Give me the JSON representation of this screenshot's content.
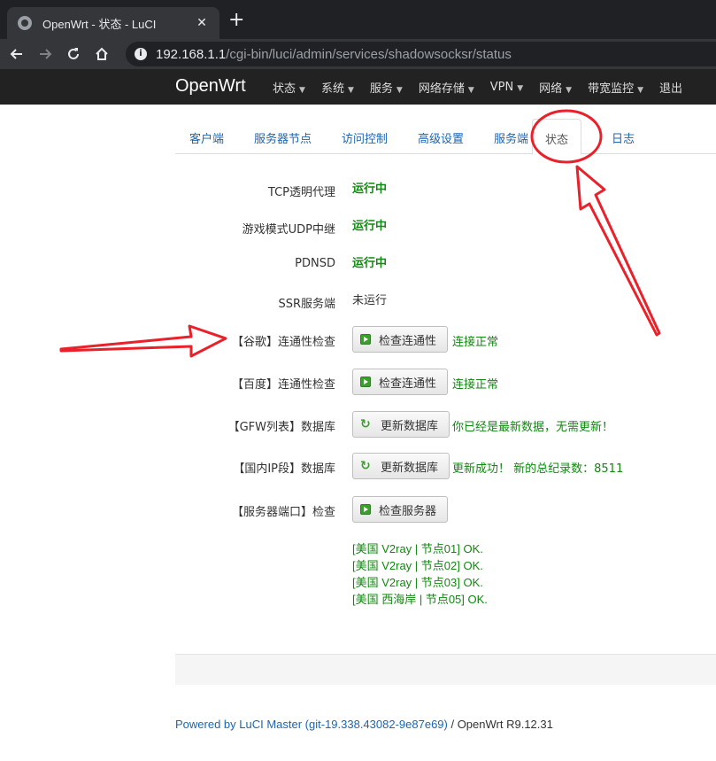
{
  "browser": {
    "tab_title": "OpenWrt - 状态 - LuCI",
    "tab_close": "✕",
    "new_tab": "+",
    "url_host": "192.168.1.1",
    "url_path": "/cgi-bin/luci/admin/services/shadowsocksr/status"
  },
  "header": {
    "brand": "OpenWrt",
    "menu": [
      "状态",
      "系统",
      "服务",
      "网络存储",
      "VPN",
      "网络",
      "带宽监控",
      "退出"
    ]
  },
  "subtabs": [
    "客户端",
    "服务器节点",
    "访问控制",
    "高级设置",
    "服务端",
    "状态",
    "日志"
  ],
  "status_rows": [
    {
      "label": "TCP透明代理",
      "value": "运行中"
    },
    {
      "label": "游戏模式UDP中继",
      "value": "运行中"
    },
    {
      "label": "PDNSD",
      "value": "运行中"
    },
    {
      "label": "SSR服务端",
      "value": "未运行"
    }
  ],
  "action_rows": [
    {
      "label": "【谷歌】连通性检查",
      "button": "检查连通性",
      "result": "连接正常"
    },
    {
      "label": "【百度】连通性检查",
      "button": "检查连通性",
      "result": "连接正常"
    },
    {
      "label": "【GFW列表】数据库",
      "button": "更新数据库",
      "result": "你已经是最新数据，无需更新！"
    },
    {
      "label": "【国内IP段】数据库",
      "button": "更新数据库",
      "result": "更新成功！ 新的总纪录数：8511"
    },
    {
      "label": "【服务器端口】检查",
      "button": "检查服务器",
      "result": ""
    }
  ],
  "server_results": [
    "[美国 V2ray | 节点01] OK.",
    "[美国 V2ray | 节点02] OK.",
    "[美国 V2ray | 节点03] OK.",
    "[美国 西海岸 | 节点05] OK."
  ],
  "footer": {
    "link": "Powered by LuCI Master (git-19.338.43082-9e87e69)",
    "text": " / OpenWrt R9.12.31"
  },
  "colors": {
    "accent": "#1a66b3",
    "running": "#118811",
    "annotation": "#e8212a"
  }
}
